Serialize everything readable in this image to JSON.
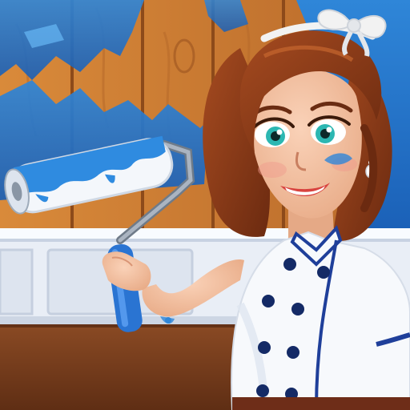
{
  "scene": {
    "subject": "chef-woman-painting-wall",
    "palette": {
      "wood_orange": "#d98a3a",
      "wood_shadow": "#b8692a",
      "paint_blue": "#2f86d8",
      "paint_light": "#6fc3ff",
      "wainscot": "#e9eef6",
      "floor": "#7a3f1e",
      "hair": "#8b3f1c",
      "hair_shadow": "#5d2811",
      "skin": "#f3c2a3",
      "chef_coat": "#f7f9fc",
      "trim_blue": "#1f3f9a",
      "button_navy": "#142a66",
      "eye": "#2cb7b2",
      "lips": "#d8433f",
      "bow": "#f2f2f2"
    },
    "icons": [
      "paint-roller-icon",
      "hair-bow-icon",
      "earring-icon"
    ]
  }
}
